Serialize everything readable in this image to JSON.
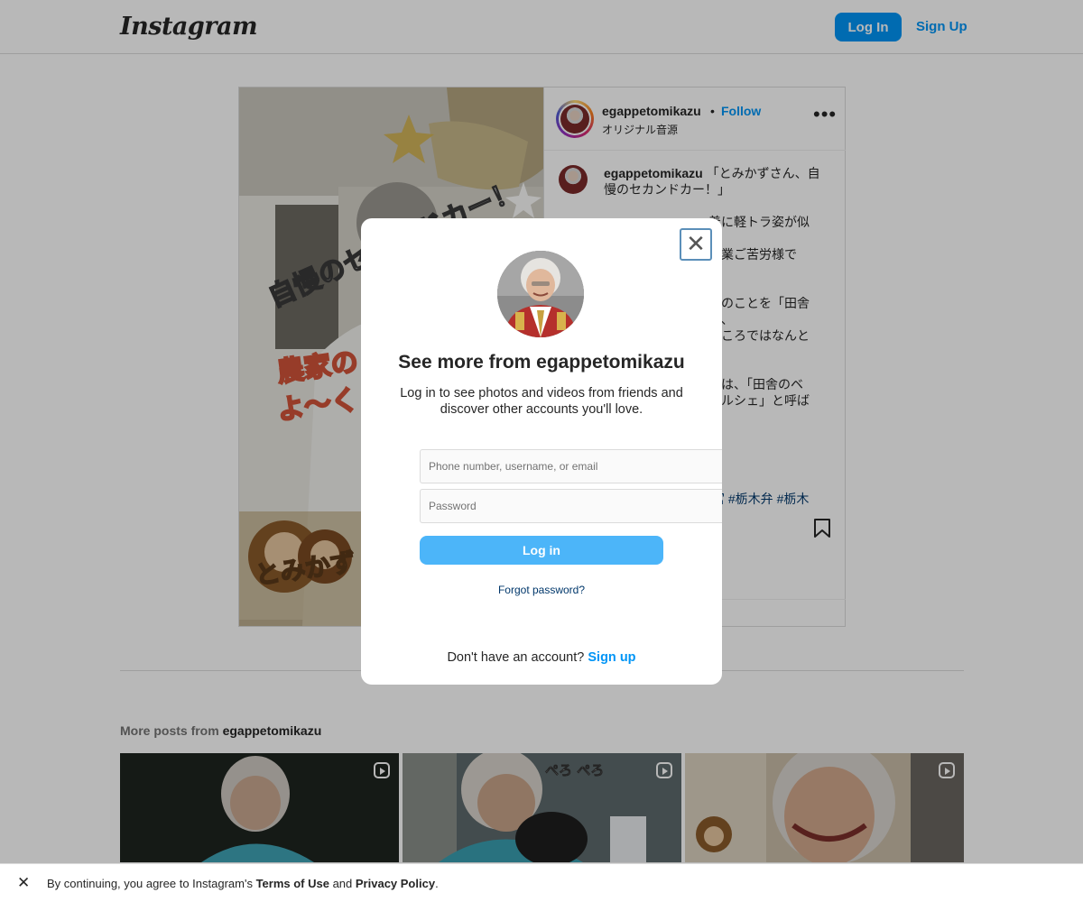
{
  "topbar": {
    "logo": "Instagram",
    "login_label": "Log In",
    "signup_label": "Sign Up"
  },
  "post": {
    "username": "egappetomikazu",
    "separator": "•",
    "follow_label": "Follow",
    "audio": "オリジナル音源",
    "more": "•••",
    "caption_user": "egappetomikazu",
    "caption_first": " 「とみかずさん、自慢のセカンドカー！」",
    "caption_lines": [
      "着に軽トラ姿が似",
      "",
      "作業ご苦労様で",
      "",
      "",
      "ラのことを「田舎",
      "が、",
      "ところではなんと",
      "",
      "",
      "では、「田舎のベ",
      "ポルシェ」と呼ば"
    ],
    "tags": "宮 #栃木弁 #栃木",
    "media_texts": {
      "arc": "自慢のセカンドカー！",
      "banner": "農家の",
      "banner2": "よ〜く",
      "bottom": "とみかず"
    }
  },
  "more_posts": {
    "prefix": "More posts from ",
    "username": "egappetomikazu",
    "tile_text": "ぺろ ぺろ"
  },
  "modal": {
    "close": "✕",
    "title": "See more from egappetomikazu",
    "description": "Log in to see photos and videos from friends and discover other accounts you'll love.",
    "username_placeholder": "Phone number, username, or email",
    "password_placeholder": "Password",
    "login_label": "Log in",
    "forgot_label": "Forgot password?",
    "no_account_text": "Don't have an account? ",
    "signup_label": "Sign up"
  },
  "cookie": {
    "close": "✕",
    "text_1": "By continuing, you agree to Instagram's ",
    "terms": "Terms of Use",
    "text_2": " and ",
    "privacy": "Privacy Policy",
    "text_3": "."
  },
  "colors": {
    "accent": "#0095f6",
    "accent_light": "#4cb5f9",
    "link_dark": "#00376b"
  }
}
